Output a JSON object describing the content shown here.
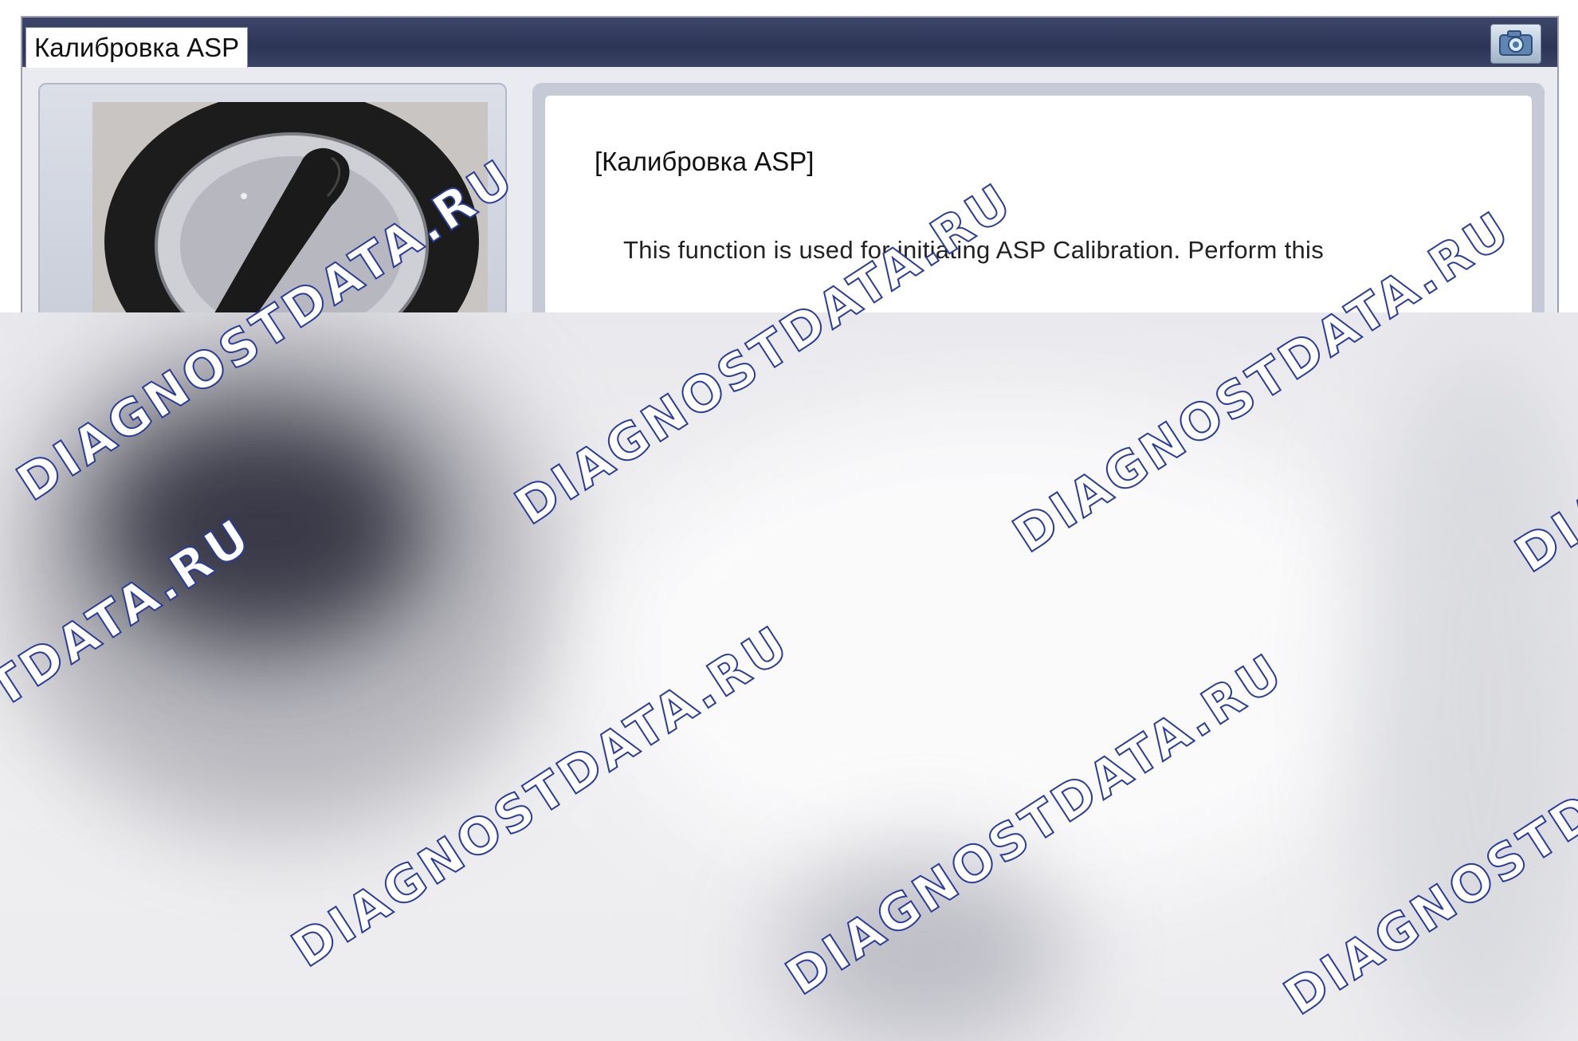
{
  "window": {
    "title": "Калибровка ASP",
    "camera_icon": "camera-icon"
  },
  "panel": {
    "heading": "[Калибровка ASP]",
    "description": "This function is used for initiating ASP Calibration. Perform this"
  },
  "watermark": {
    "text": "DIAGNOSTDATA.RU",
    "stroke_color": "#2b3c9a"
  },
  "colors": {
    "titlebar": "#2d3556",
    "panel_frame": "#c6cad6"
  }
}
